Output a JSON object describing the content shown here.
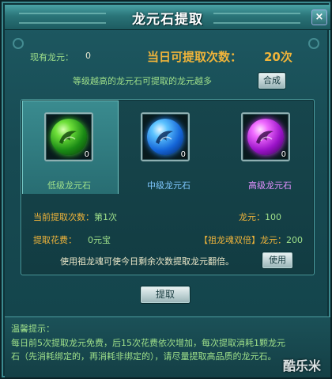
{
  "window": {
    "title": "龙元石提取",
    "close_label": "×"
  },
  "summary": {
    "own_label": "现有龙元：",
    "own_value": "0",
    "daily_label": "当日可提取次数：",
    "daily_value": "20次"
  },
  "hint": {
    "text": "等级越高的龙元石可提取的龙元越多",
    "compose_label": "合成"
  },
  "stones": [
    {
      "name": "低级龙元石",
      "count": "0",
      "color": "#3fd02a",
      "icon": "green-dragon-orb-icon"
    },
    {
      "name": "中级龙元石",
      "count": "0",
      "color": "#2a8cff",
      "icon": "blue-dragon-orb-icon"
    },
    {
      "name": "高级龙元石",
      "count": "0",
      "color": "#d03aff",
      "icon": "purple-dragon-orb-icon"
    }
  ],
  "details": {
    "current_times_label": "当前提取次数：",
    "current_times_value": "第1次",
    "stone_label_a": "龙元：",
    "stone_value_a": "100",
    "cost_label": "提取花费：",
    "cost_value": "0元宝",
    "bonus_label": "【祖龙魂双倍】",
    "stone_label_b": "龙元：",
    "stone_value_b": "200",
    "use_hint": "使用祖龙魂可使今日剩余次数提取龙元翻倍。",
    "use_label": "使用"
  },
  "actions": {
    "extract_label": "提取"
  },
  "tips": {
    "title": "温馨提示：",
    "line1": "每日前5次提取龙元免费，后15次花费依次增加，每次提取消耗1颗龙元",
    "line2": "石（先消耗绑定的，再消耗非绑定的），请尽量提取高品质的龙元石。"
  },
  "colors": {
    "accent_gold": "#f0b43a",
    "accent_green": "#9fe08a",
    "panel_teal": "#17464d"
  }
}
